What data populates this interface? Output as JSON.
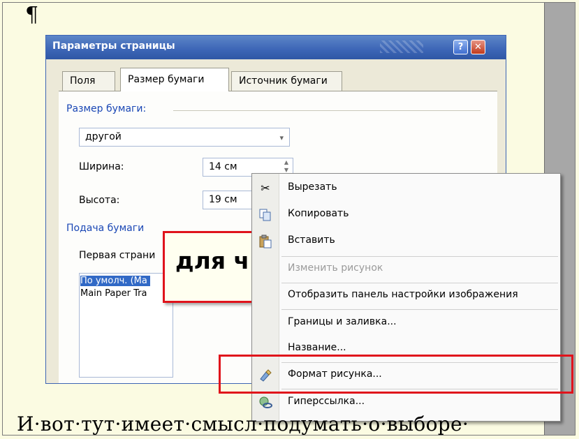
{
  "document": {
    "pilcrow": "¶",
    "bottom_text": "И·вот·тут·имеет·смысл·подумать·о·выборе·"
  },
  "dialog": {
    "title": "Параметры страницы",
    "help_button": "?",
    "close_button": "✕",
    "tabs": [
      {
        "label": "Поля"
      },
      {
        "label": "Размер бумаги"
      },
      {
        "label": "Источник бумаги"
      }
    ],
    "paper_size": {
      "section_label": "Размер бумаги:",
      "combo_value": "другой",
      "width_label": "Ширина:",
      "width_value": "14 см",
      "height_label": "Высота:",
      "height_value": "19 см"
    },
    "paper_source": {
      "section_label": "Подача бумаги",
      "first_page_label": "Первая страни",
      "list_items": [
        "По умолч. (Ма",
        "Main Paper Tra"
      ]
    }
  },
  "callout": {
    "text": "для ч"
  },
  "context_menu": {
    "items": [
      {
        "label": "Вырезать",
        "icon": "scissors-icon",
        "enabled": true
      },
      {
        "label": "Копировать",
        "icon": "copy-icon",
        "enabled": true
      },
      {
        "label": "Вставить",
        "icon": "paste-icon",
        "enabled": true
      },
      {
        "label": "Изменить рисунок",
        "icon": "",
        "enabled": false
      },
      {
        "label": "Отобразить панель настройки изображения",
        "icon": "",
        "enabled": true
      },
      {
        "label": "Границы и заливка...",
        "icon": "",
        "enabled": true
      },
      {
        "label": "Название...",
        "icon": "",
        "enabled": true
      },
      {
        "label": "Формат рисунка...",
        "icon": "format-picture-icon",
        "enabled": true
      },
      {
        "label": "Гиперссылка...",
        "icon": "hyperlink-icon",
        "enabled": true
      }
    ]
  },
  "colors": {
    "document_background": "#fbfbe2",
    "highlight_border": "#e0131b",
    "titlebar": "#3c65b6",
    "section_label": "#1a47b5"
  }
}
